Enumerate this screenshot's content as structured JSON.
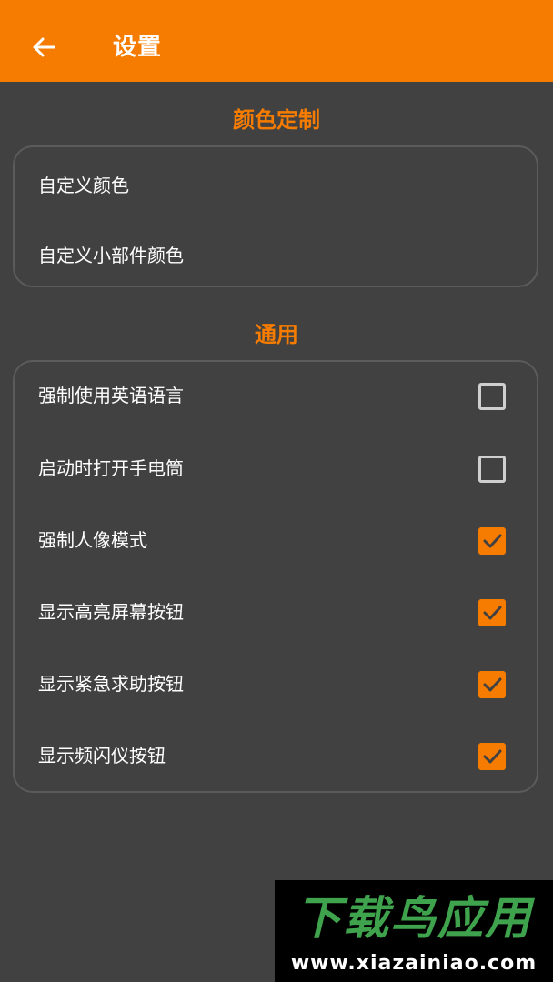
{
  "app_bar": {
    "title": "设置",
    "back_icon": "arrow-left-icon",
    "background_color": "#f57c00"
  },
  "sections": {
    "color_custom": {
      "title": "颜色定制",
      "items": [
        {
          "label": "自定义颜色"
        },
        {
          "label": "自定义小部件颜色"
        }
      ]
    },
    "general": {
      "title": "通用",
      "items": [
        {
          "label": "强制使用英语语言",
          "checked": false
        },
        {
          "label": "启动时打开手电筒",
          "checked": false
        },
        {
          "label": "强制人像模式",
          "checked": true
        },
        {
          "label": "显示高亮屏幕按钮",
          "checked": true
        },
        {
          "label": "显示紧急求助按钮",
          "checked": true
        },
        {
          "label": "显示频闪仪按钮",
          "checked": true
        }
      ]
    }
  },
  "colors": {
    "accent": "#f57c00",
    "background": "#414141",
    "card_border": "#5b5b5b",
    "text": "#ffffff"
  },
  "watermark": {
    "logo": "下载鸟应用",
    "url": "www.xiazainiao.com"
  }
}
